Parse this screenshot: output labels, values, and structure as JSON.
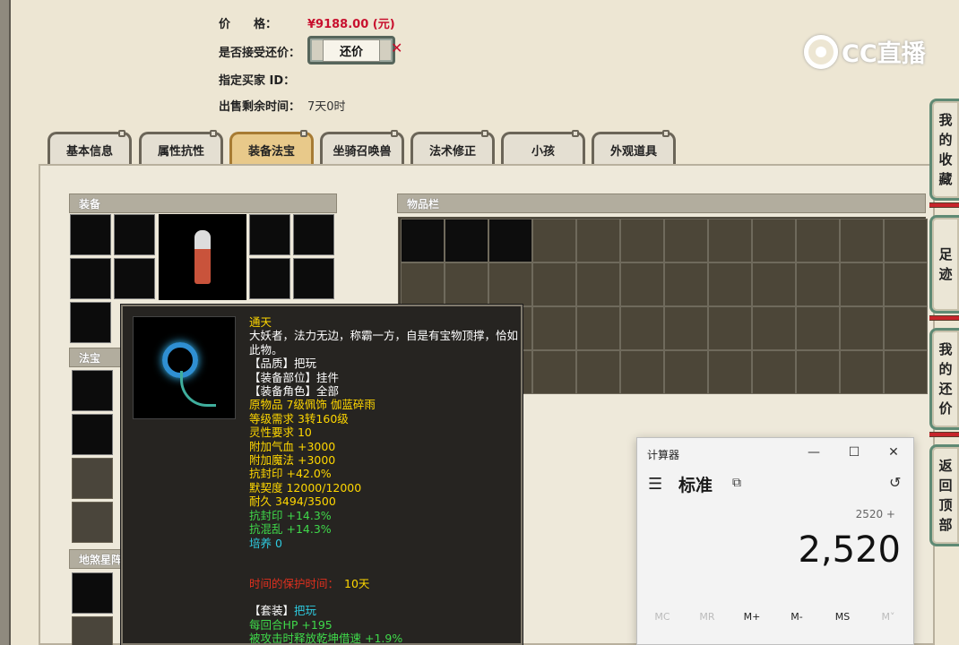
{
  "form": {
    "price_label": "价　　格：",
    "price_value": "¥9188.00 (元)",
    "accept_counter_label": "是否接受还价：",
    "counter_button_label": "还价",
    "buyer_id_label": "指定买家 ID：",
    "time_left_label": "出售剩余时间：",
    "time_left_value": "7天0时"
  },
  "tabs": [
    {
      "label": "基本信息",
      "active": false
    },
    {
      "label": "属性抗性",
      "active": false
    },
    {
      "label": "装备法宝",
      "active": true
    },
    {
      "label": "坐骑召唤兽",
      "active": false
    },
    {
      "label": "法术修正",
      "active": false
    },
    {
      "label": "小孩",
      "active": false
    },
    {
      "label": "外观道具",
      "active": false
    }
  ],
  "panels": {
    "equipment_header": "装备",
    "treasure_header": "法宝",
    "star_header": "地煞星阵",
    "inventory_header": "物品栏"
  },
  "tooltip": {
    "name": "通天",
    "description": "大妖者，法力无边，称霸一方，自是有宝物顶撑，恰如此物。",
    "quality": "【品质】把玩",
    "slot": "【装备部位】挂件",
    "role": "【装备角色】全部",
    "origin": "原物品 7级佩饰 伽蓝碎雨",
    "level_req": "等级需求 3转160级",
    "spirit_req": "灵性要求 10",
    "hp_bonus": "附加气血 +3000",
    "mp_bonus": "附加魔法 +3000",
    "seal_res": "抗封印 +42.0%",
    "tacit": "默契度 12000/12000",
    "durability": "耐久 3494/3500",
    "seal_res2": "抗封印 +14.3%",
    "chaos_res": "抗混乱 +14.3%",
    "cultivate": "培养 0",
    "protect_label": "时间的保护时间：",
    "protect_value": "10天",
    "set_label": "【套装】",
    "set_value": "把玩",
    "set_effect1": "每回合HP +195",
    "set_effect2": "被攻击时释放乾坤借速 +1.9%"
  },
  "watermark": "CC直播",
  "side_buttons": [
    {
      "label": [
        "我",
        "的",
        "收",
        "藏"
      ]
    },
    {
      "label": [
        "足",
        "迹"
      ]
    },
    {
      "label": [
        "我",
        "的",
        "还",
        "价"
      ]
    },
    {
      "label": [
        "返",
        "回",
        "顶",
        "部"
      ]
    }
  ],
  "calculator": {
    "title": "计算器",
    "minimize": "—",
    "maximize": "☐",
    "close": "✕",
    "menu_icon": "☰",
    "mode": "标准",
    "keep_on_top_icon": "⧉",
    "history_icon": "↺",
    "expression": "2520 +",
    "display": "2,520",
    "memory_buttons": [
      "MC",
      "MR",
      "M+",
      "M-",
      "MS",
      "M˅"
    ]
  }
}
